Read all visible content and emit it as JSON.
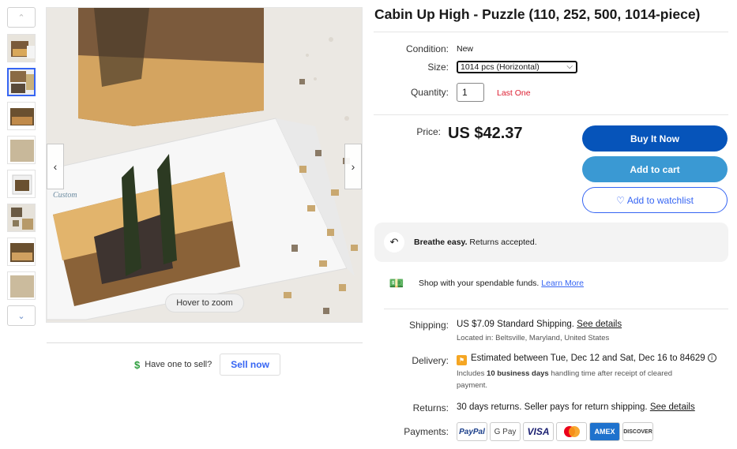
{
  "product": {
    "title": "Cabin Up High - Puzzle (110, 252, 500, 1014-piece)"
  },
  "gallery": {
    "thumbnail_count": 8,
    "selected_index": 1,
    "zoom_hint": "Hover to zoom",
    "prev_icon": "chevron-left-icon",
    "next_icon": "chevron-right-icon"
  },
  "sell": {
    "prompt": "Have one to sell?",
    "button": "Sell now"
  },
  "details": {
    "condition_label": "Condition:",
    "condition_value": "New",
    "size_label": "Size:",
    "size_value": "1014 pcs (Horizontal)",
    "quantity_label": "Quantity:",
    "quantity_value": "1",
    "stock_note": "Last One"
  },
  "pricing": {
    "price_label": "Price:",
    "price_value": "US $42.37"
  },
  "actions": {
    "buy_now": "Buy It Now",
    "add_to_cart": "Add to cart",
    "watchlist": "Add to watchlist"
  },
  "returns_banner": {
    "bold": "Breathe easy.",
    "text": " Returns accepted."
  },
  "funds_banner": {
    "text": "Shop with your spendable funds. ",
    "link": "Learn More"
  },
  "shipping": {
    "label": "Shipping:",
    "value": "US $7.09 Standard Shipping. ",
    "details_link": "See details",
    "location": "Located in: Beltsville, Maryland, United States"
  },
  "delivery": {
    "label": "Delivery:",
    "estimate_prefix": "Estimated between ",
    "estimate_dates": "Tue, Dec 12 and Sat, Dec 16",
    "estimate_suffix": " to 84629",
    "note_prefix": "Includes ",
    "note_bold": "10 business days",
    "note_suffix": " handling time after receipt of cleared",
    "note_line2": "payment."
  },
  "returns": {
    "label": "Returns:",
    "value": "30 days returns. Seller pays for return shipping. ",
    "details_link": "See details"
  },
  "payments": {
    "label": "Payments:",
    "methods": [
      "PayPal",
      "G Pay",
      "VISA",
      "Mastercard",
      "AMEX",
      "DISCOVER"
    ]
  },
  "colors": {
    "buy_now": "#0654ba",
    "add_to_cart": "#3a99d3",
    "link": "#3665f3",
    "stock_warning": "#dd1e31"
  }
}
